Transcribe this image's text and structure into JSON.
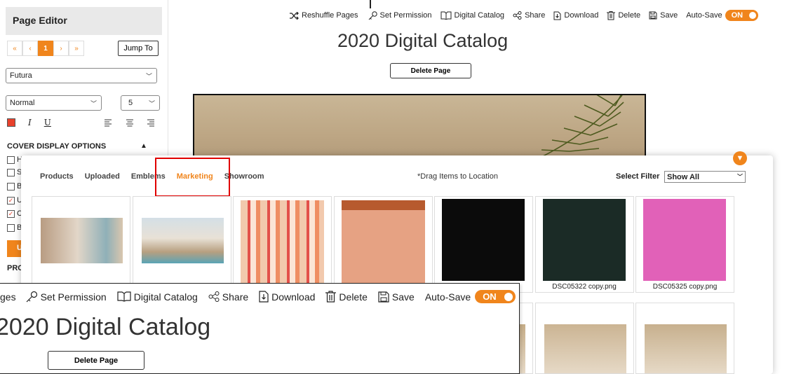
{
  "sidebar": {
    "title": "Page Editor",
    "pager": [
      "«",
      "‹",
      "1",
      "›",
      "»"
    ],
    "jump_label": "Jump To",
    "font_value": "Futura",
    "style_value": "Normal",
    "size_value": "5",
    "italic": "I",
    "underline": "U",
    "color_value": "#e8412c",
    "cover_heading": "COVER DISPLAY OPTIONS",
    "checkbox_letters": [
      "H",
      "S",
      "B",
      "U",
      "C",
      "B"
    ],
    "checkbox_checked": [
      false,
      false,
      false,
      true,
      true,
      false
    ],
    "button_letter": "U",
    "bottom_heading": "PRO"
  },
  "toolbar": {
    "reshuffle": "Reshuffle Pages",
    "permission": "Set Permission",
    "catalog": "Digital Catalog",
    "share": "Share",
    "download": "Download",
    "delete": "Delete",
    "save": "Save",
    "autosave": "Auto-Save",
    "toggle": "ON"
  },
  "page": {
    "title": "2020 Digital Catalog",
    "delete_page": "Delete Page"
  },
  "media": {
    "tabs": [
      "Products",
      "Uploaded",
      "Emblems",
      "Marketing",
      "Showroom"
    ],
    "active_tab": "Marketing",
    "hint": "*Drag Items to Location",
    "filter_label": "Select Filter",
    "filter_value": "Show All",
    "tiles_row1": [
      {
        "caption": "",
        "color": "#d9c6ae"
      },
      {
        "caption": "",
        "color": "#c8b59e"
      },
      {
        "caption": "",
        "color": "#e99a7c"
      },
      {
        "caption": "",
        "color": "#e3a07f"
      },
      {
        "caption": "",
        "color": "#0b0b0b"
      },
      {
        "caption": "DSC05322 copy.png",
        "color": "#1b2b26"
      },
      {
        "caption": "DSC05325 copy.png",
        "color": "#e161b8"
      }
    ],
    "tiles_row2": [
      {
        "caption": "",
        "color": "#c6ad88"
      },
      {
        "caption": "",
        "color": "#cbb493"
      },
      {
        "caption": "",
        "color": "#c7b08e"
      }
    ]
  },
  "zoom": {
    "partial_reshuffle": "ges",
    "permission": "Set Permission",
    "catalog": "Digital Catalog",
    "share": "Share",
    "download": "Download",
    "delete": "Delete",
    "save": "Save",
    "autosave": "Auto-Save",
    "toggle": "ON",
    "title": "2020 Digital Catalog",
    "delete_page": "Delete Page"
  },
  "colors": {
    "accent": "#f0851c",
    "highlight": "#e00000"
  }
}
